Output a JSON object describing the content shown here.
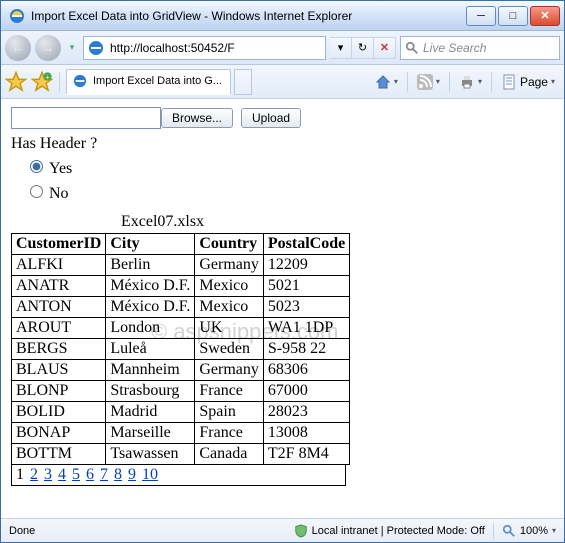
{
  "window": {
    "title": "Import Excel Data into GridView - Windows Internet Explorer",
    "url": "http://localhost:50452/F",
    "search_placeholder": "Live Search",
    "tab_title": "Import Excel Data into G..."
  },
  "toolbar": {
    "page_label": "Page"
  },
  "page": {
    "browse_label": "Browse...",
    "upload_label": "Upload",
    "question": "Has Header ?",
    "yes_label": "Yes",
    "no_label": "No",
    "caption": "Excel07.xlsx",
    "watermark": "© aspsnippets.com"
  },
  "grid": {
    "headers": [
      "CustomerID",
      "City",
      "Country",
      "PostalCode"
    ],
    "rows": [
      [
        "ALFKI",
        "Berlin",
        "Germany",
        "12209"
      ],
      [
        "ANATR",
        "México D.F.",
        "Mexico",
        "5021"
      ],
      [
        "ANTON",
        "México D.F.",
        "Mexico",
        "5023"
      ],
      [
        "AROUT",
        "London",
        "UK",
        "WA1 1DP"
      ],
      [
        "BERGS",
        "Luleå",
        "Sweden",
        "S-958 22"
      ],
      [
        "BLAUS",
        "Mannheim",
        "Germany",
        "68306"
      ],
      [
        "BLONP",
        "Strasbourg",
        "France",
        "67000"
      ],
      [
        "BOLID",
        "Madrid",
        "Spain",
        "28023"
      ],
      [
        "BONAP",
        "Marseille",
        "France",
        "13008"
      ],
      [
        "BOTTM",
        "Tsawassen",
        "Canada",
        "T2F 8M4"
      ]
    ],
    "pager": {
      "current": 1,
      "pages": [
        1,
        2,
        3,
        4,
        5,
        6,
        7,
        8,
        9,
        10
      ]
    }
  },
  "status": {
    "done": "Done",
    "zone": "Local intranet | Protected Mode: Off",
    "zoom": "100%"
  }
}
